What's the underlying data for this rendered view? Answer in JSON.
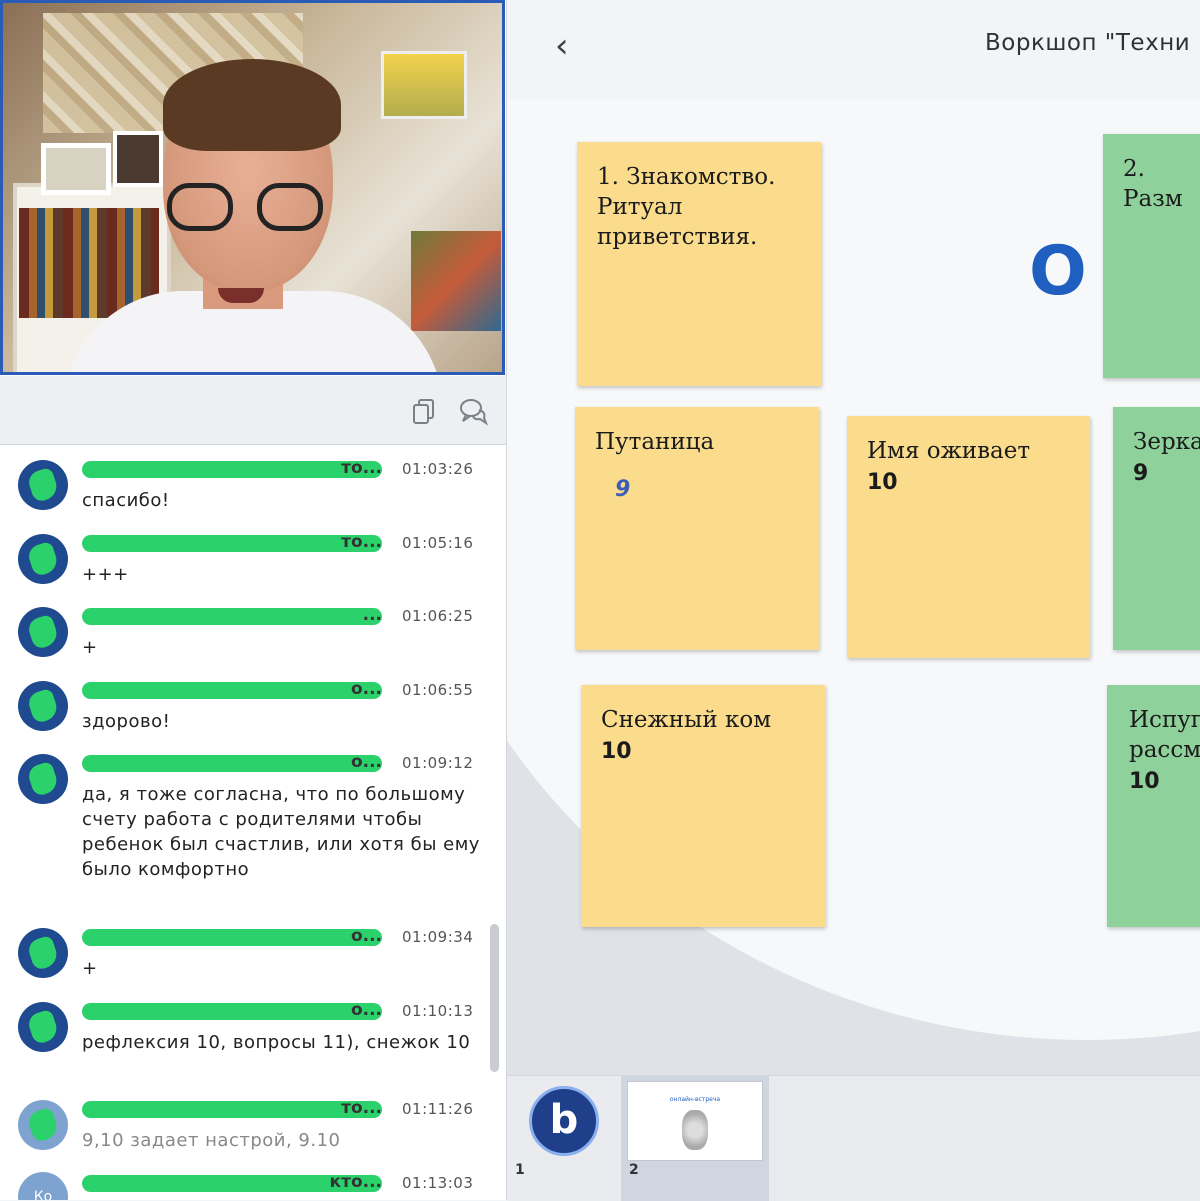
{
  "presentation": {
    "title": "Воркшоп \"Техни",
    "back_icon": "chevron-left-icon",
    "partial_heading": "О"
  },
  "sticky_notes": [
    {
      "text": "1. Знакомство. Ритуал приветствия.",
      "vote": "",
      "color": "#fadc8c"
    },
    {
      "text": "2. Разм",
      "vote": "",
      "color": "#8fd19a"
    },
    {
      "text": "Путаница",
      "vote": "9",
      "color": "#fadc8c"
    },
    {
      "text": "Имя оживает",
      "vote": "10",
      "color": "#fadc8c"
    },
    {
      "text": "Зерка",
      "vote": "9",
      "color": "#8fd19a"
    },
    {
      "text": "Снежный ком",
      "vote": "10",
      "color": "#fadc8c"
    },
    {
      "text": "Испуг рассме",
      "vote": "10",
      "color": "#8fd19a"
    }
  ],
  "chat_toolbar": {
    "copy_icon": "copy-icon",
    "chat_icon": "chat-bubbles-icon"
  },
  "chat": {
    "messages": [
      {
        "name_tail": "то...",
        "time": "01:03:26",
        "text": "спасибо!"
      },
      {
        "name_tail": "то...",
        "time": "01:05:16",
        "text": "+++"
      },
      {
        "name_tail": "...",
        "time": "01:06:25",
        "text": "+"
      },
      {
        "name_tail": "о...",
        "time": "01:06:55",
        "text": "здорово!"
      },
      {
        "name_tail": "о...",
        "time": "01:09:12",
        "text": "да, я тоже согласна, что по большому счету работа с родителями чтобы ребенок был счастлив, или хотя бы ему было комфортно"
      },
      {
        "name_tail": "о...",
        "time": "01:09:34",
        "text": "+"
      },
      {
        "name_tail": "о...",
        "time": "01:10:13",
        "text": "рефлексия 10, вопросы 11), снежок 10"
      },
      {
        "name_tail": "то...",
        "time": "01:11:26",
        "text": "9,10 задает настрой, 9.10"
      },
      {
        "name_tail": "кто...",
        "time": "01:13:03",
        "text": "",
        "avatar_initials": "Ко"
      }
    ]
  },
  "thumbnails": [
    {
      "number": "1",
      "label": "b"
    },
    {
      "number": "2",
      "label": "онлайн-встреча"
    }
  ],
  "colors": {
    "accent": "#1f5fbf",
    "video_border": "#2a5bb5",
    "scribble": "#2bd26b"
  }
}
